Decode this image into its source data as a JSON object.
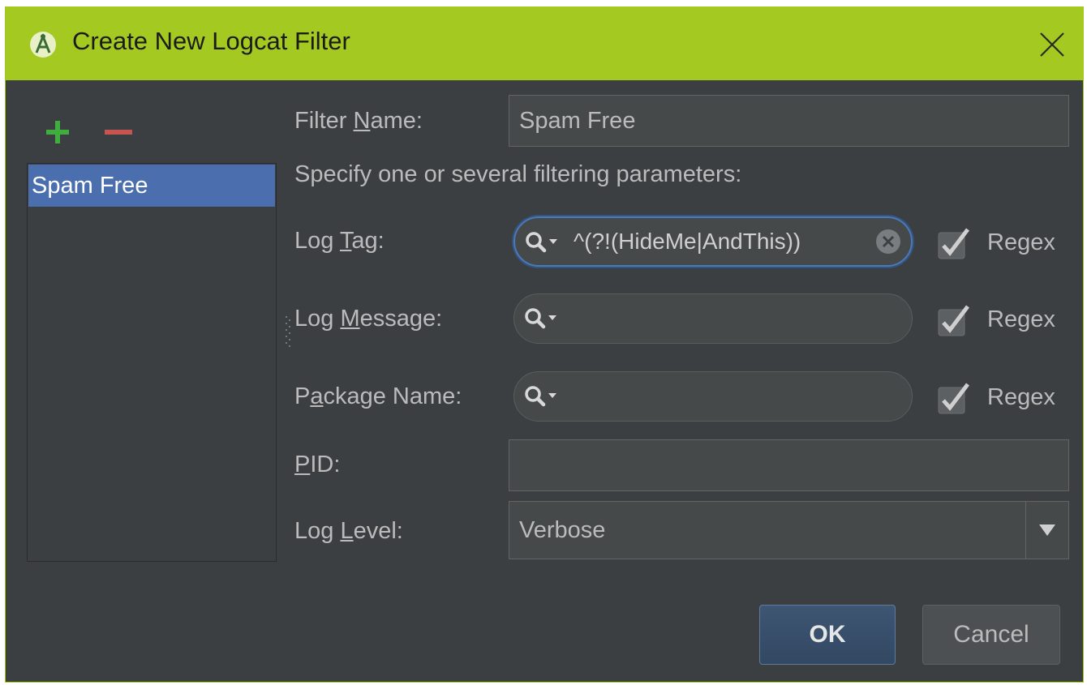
{
  "dialog": {
    "title": "Create New Logcat Filter"
  },
  "colors": {
    "title_bar": "#a4c920",
    "background": "#3c3f41",
    "selection": "#4b6eaf",
    "add_icon": "#3fae3f",
    "remove_icon": "#c75450"
  },
  "sidebar": {
    "filters": [
      {
        "label": "Spam Free",
        "selected": true
      }
    ]
  },
  "form": {
    "filter_name": {
      "label_prefix": "Filter ",
      "label_mnemonic": "N",
      "label_suffix": "ame:",
      "value": "Spam Free"
    },
    "hint": "Specify one or several filtering parameters:",
    "log_tag": {
      "label_prefix": "Log ",
      "label_mnemonic": "T",
      "label_suffix": "ag:",
      "value": "^(?!(HideMe|AndThis))",
      "regex_label": "Regex",
      "regex_checked": true
    },
    "log_message": {
      "label_prefix": "Log ",
      "label_mnemonic": "M",
      "label_suffix": "essage:",
      "value": "",
      "regex_label": "Regex",
      "regex_checked": true
    },
    "package_name": {
      "label_prefix": "P",
      "label_mnemonic": "a",
      "label_suffix": "ckage Name:",
      "value": "",
      "regex_label": "Regex",
      "regex_checked": true
    },
    "pid": {
      "label_prefix": "",
      "label_mnemonic": "P",
      "label_suffix": "ID:",
      "value": ""
    },
    "log_level": {
      "label_prefix": "Log ",
      "label_mnemonic": "L",
      "label_suffix": "evel:",
      "value": "Verbose"
    }
  },
  "buttons": {
    "ok": "OK",
    "cancel": "Cancel"
  },
  "icons": [
    "android-studio-icon",
    "close-icon",
    "add-icon",
    "remove-icon",
    "search-icon",
    "clear-icon",
    "checkbox-icon",
    "dropdown-arrow-icon"
  ]
}
